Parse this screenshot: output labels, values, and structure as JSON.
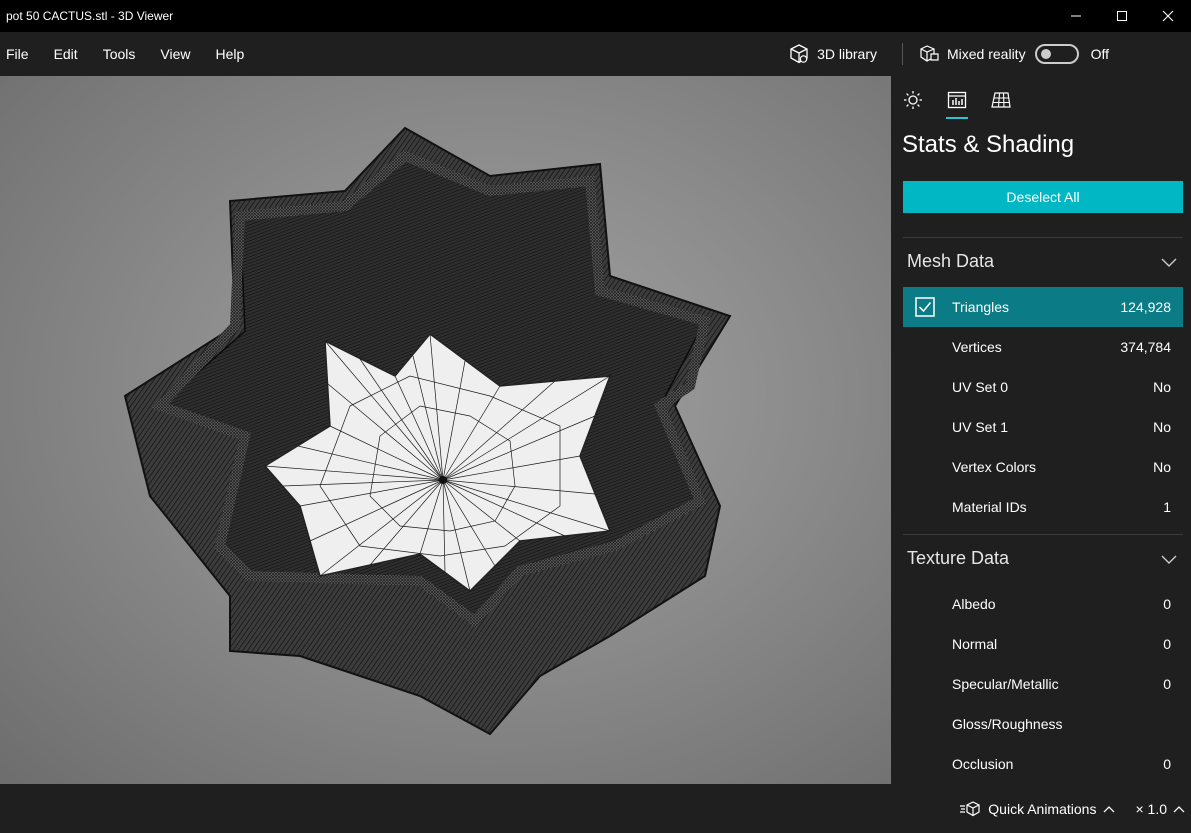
{
  "window": {
    "title": "pot 50 CACTUS.stl - 3D Viewer"
  },
  "menu": {
    "items": [
      "File",
      "Edit",
      "Tools",
      "View",
      "Help"
    ],
    "library_label": "3D library",
    "mixed_reality_label": "Mixed reality",
    "toggle_state": "Off"
  },
  "panel": {
    "tabs": [
      {
        "icon": "lighting-icon",
        "active": false
      },
      {
        "icon": "stats-icon",
        "active": true
      },
      {
        "icon": "mesh-grid-icon",
        "active": false
      }
    ],
    "title": "Stats & Shading",
    "deselect_label": "Deselect All",
    "mesh_section": {
      "title": "Mesh Data",
      "rows": [
        {
          "label": "Triangles",
          "value": "124,928",
          "checked": true
        },
        {
          "label": "Vertices",
          "value": "374,784"
        },
        {
          "label": "UV Set 0",
          "value": "No"
        },
        {
          "label": "UV Set 1",
          "value": "No"
        },
        {
          "label": "Vertex Colors",
          "value": "No"
        },
        {
          "label": "Material IDs",
          "value": "1"
        }
      ]
    },
    "texture_section": {
      "title": "Texture Data",
      "rows": [
        {
          "label": "Albedo",
          "value": "0"
        },
        {
          "label": "Normal",
          "value": "0"
        },
        {
          "label": "Specular/Metallic",
          "value": "0"
        },
        {
          "label": "Gloss/Roughness",
          "value": ""
        },
        {
          "label": "Occlusion",
          "value": "0"
        }
      ]
    }
  },
  "bottombar": {
    "quick_animations_label": "Quick Animations",
    "zoom_label": "× 1.0"
  },
  "colors": {
    "accent": "#00b7c3",
    "selected_row": "#0b7c86",
    "background": "#1f1f1f",
    "titlebar": "#000000"
  }
}
